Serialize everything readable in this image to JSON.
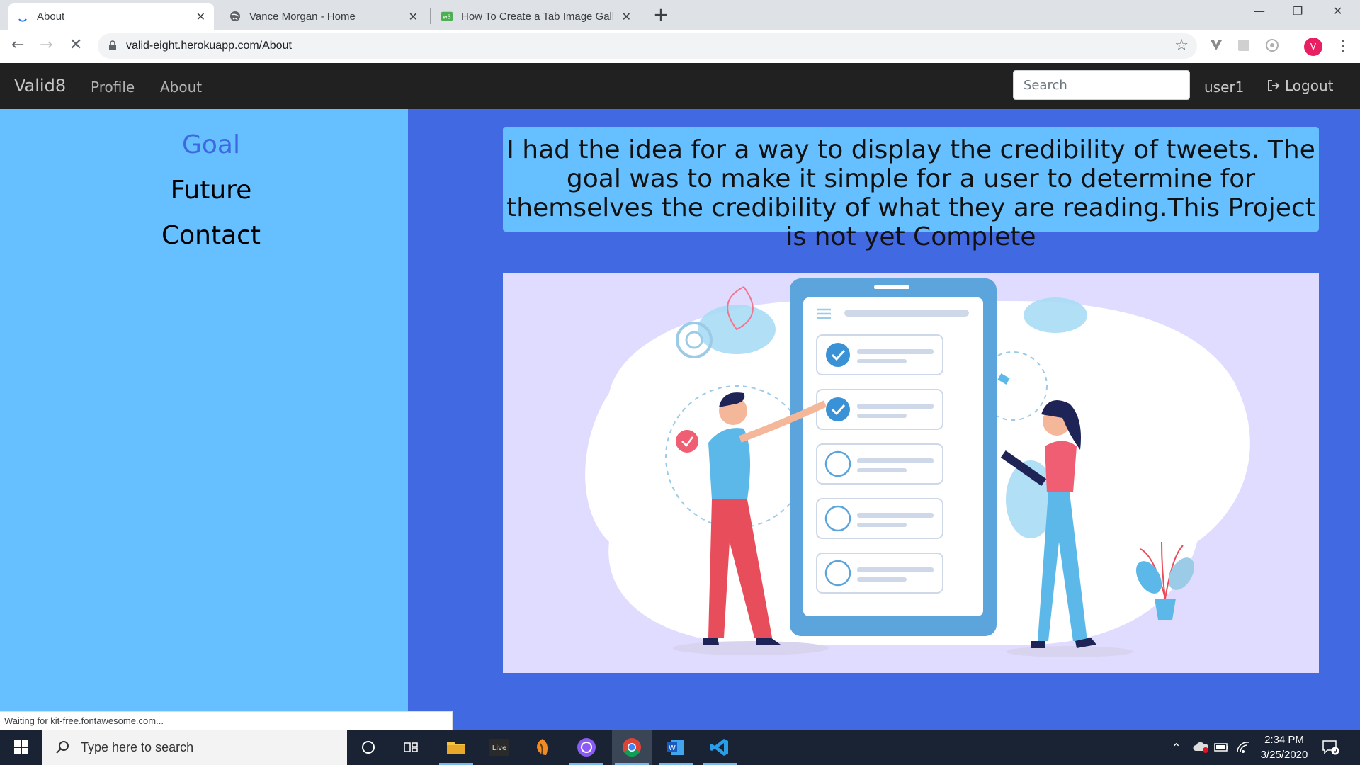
{
  "browser": {
    "tabs": [
      {
        "title": "About",
        "active": true
      },
      {
        "title": "Vance Morgan - Home",
        "active": false
      },
      {
        "title": "How To Create a Tab Image Galle",
        "active": false
      }
    ],
    "url": "valid-eight.herokuapp.com/About",
    "profile_initial": "V",
    "status_text": "Waiting for kit-free.fontawesome.com..."
  },
  "site": {
    "brand": "Valid8",
    "nav_links": [
      "Profile",
      "About"
    ],
    "search_placeholder": "Search",
    "user": "user1",
    "logout": "Logout"
  },
  "sidebar": {
    "items": [
      {
        "label": "Goal",
        "active": true
      },
      {
        "label": "Future",
        "active": false
      },
      {
        "label": "Contact",
        "active": false
      }
    ]
  },
  "main": {
    "goal_text": "I had the idea for a way to display the credibility of tweets. The goal was to make it simple for a user to determine for themselves the credibility of what they are reading.This Project is not yet Complete"
  },
  "taskbar": {
    "search_placeholder": "Type here to search",
    "time": "2:34 PM",
    "date": "3/25/2020",
    "notification_count": "9"
  },
  "colors": {
    "sidebar_bg": "#66c0ff",
    "main_bg": "#4169e1",
    "nav_bg": "#212121",
    "active_link": "#3d68e1"
  }
}
